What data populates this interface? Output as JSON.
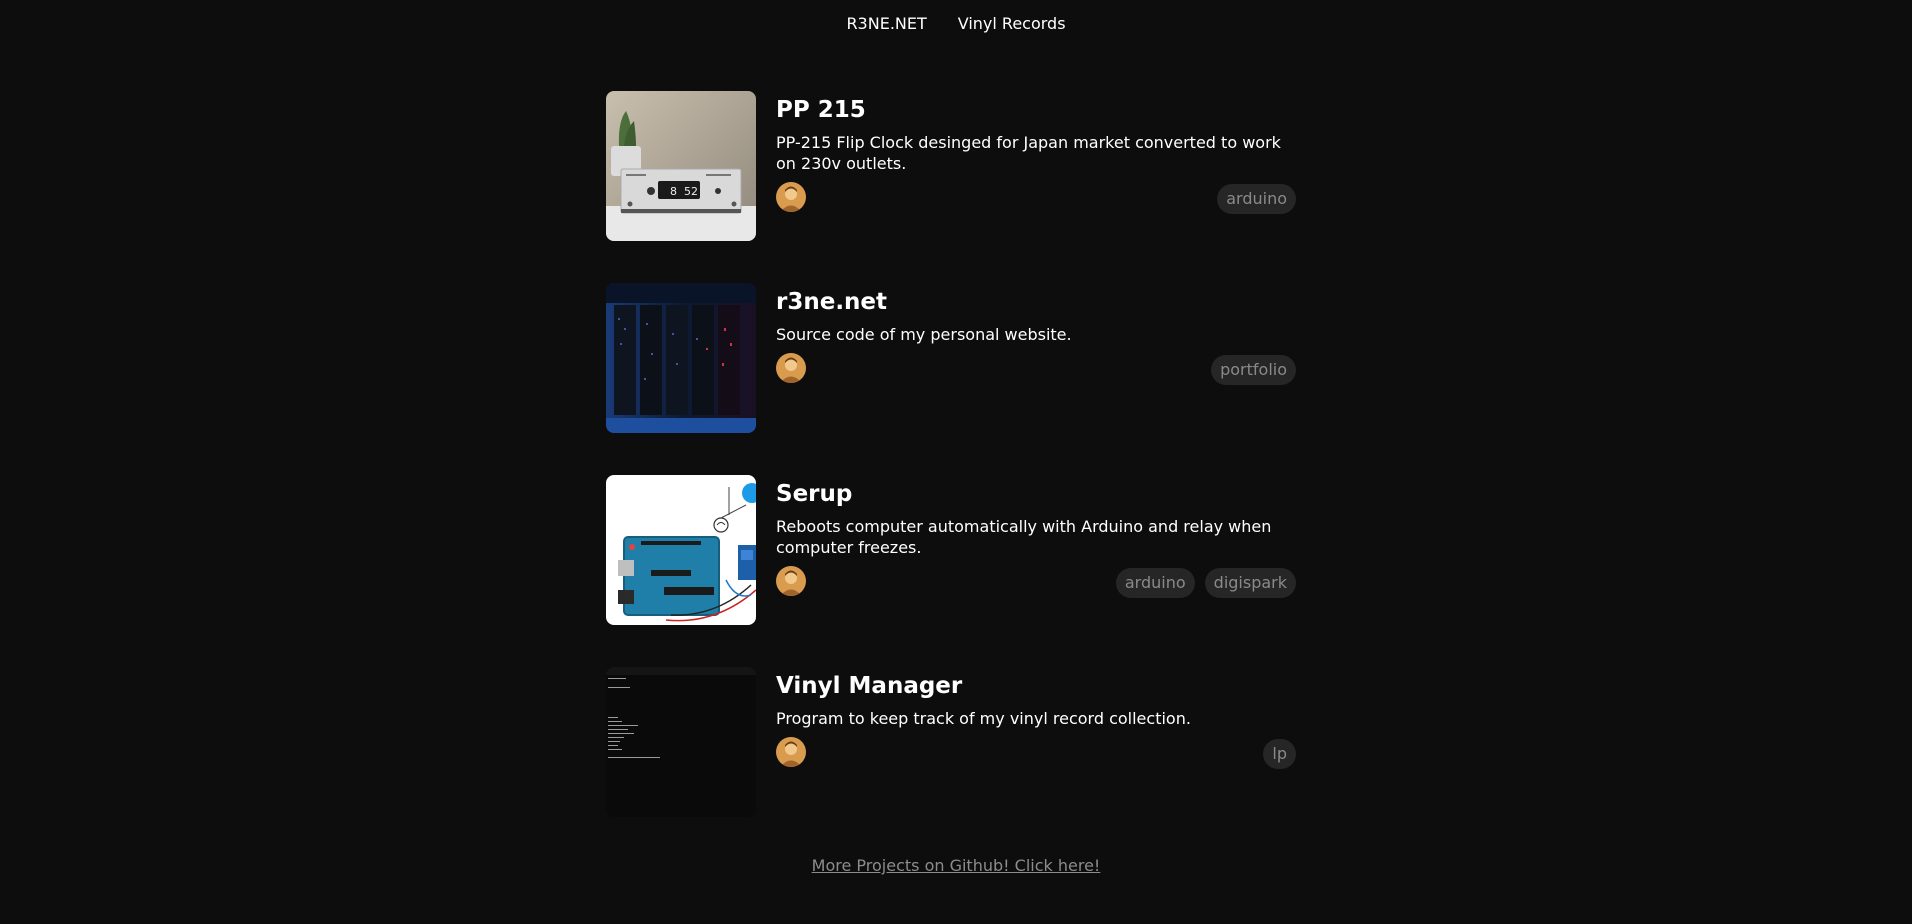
{
  "nav": {
    "home_label": "R3NE.NET",
    "vinyl_label": "Vinyl Records"
  },
  "projects": [
    {
      "title": "PP 215",
      "description": "PP-215 Flip Clock desinged for Japan market converted to work on 230v outlets.",
      "thumbnail": "flip-clock-photo",
      "tags": [
        "arduino"
      ]
    },
    {
      "title": "r3ne.net",
      "description": "Source code of my personal website.",
      "thumbnail": "server-racks-photo",
      "tags": [
        "portfolio"
      ]
    },
    {
      "title": "Serup",
      "description": "Reboots computer automatically with Arduino and relay when computer freezes.",
      "thumbnail": "arduino-relay-diagram",
      "tags": [
        "arduino",
        "digispark"
      ]
    },
    {
      "title": "Vinyl Manager",
      "description": "Program to keep track of my vinyl record collection.",
      "thumbnail": "terminal-screenshot",
      "tags": [
        "lp"
      ]
    }
  ],
  "footer": {
    "github_link_label": "More Projects on Github! Click here!"
  },
  "colors": {
    "background": "#0d0d0d",
    "text": "#ffffff",
    "tag_background": "#262626",
    "tag_text": "#8a8a8a",
    "footer_link": "#8c8c8c"
  }
}
